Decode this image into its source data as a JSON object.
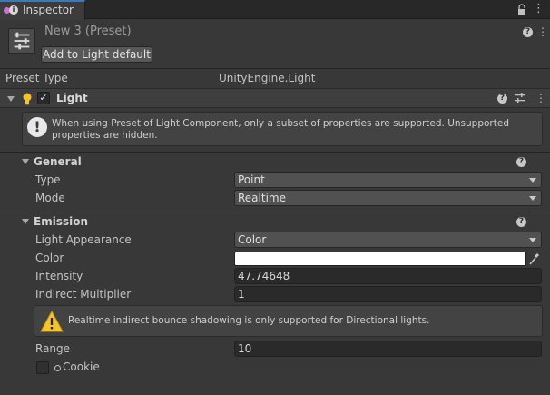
{
  "window": {
    "tab_title": "Inspector"
  },
  "header": {
    "preset_title": "New 3 (Preset)",
    "add_button_label": "Add to Light default"
  },
  "preset_type": {
    "label": "Preset Type",
    "value": "UnityEngine.Light"
  },
  "component": {
    "title": "Light",
    "enabled": true,
    "info_message": "When using Preset of Light Component, only a subset of properties are supported.  Unsupported properties are hidden."
  },
  "general": {
    "title": "General",
    "type_label": "Type",
    "type_value": "Point",
    "mode_label": "Mode",
    "mode_value": "Realtime"
  },
  "emission": {
    "title": "Emission",
    "appearance_label": "Light Appearance",
    "appearance_value": "Color",
    "color_label": "Color",
    "color_value": "#ffffff",
    "intensity_label": "Intensity",
    "intensity_value": "47.74648",
    "indirect_label": "Indirect Multiplier",
    "indirect_value": "1",
    "warning_message": "Realtime indirect bounce shadowing is only supported for Directional lights.",
    "range_label": "Range",
    "range_value": "10",
    "cookie_label": "Cookie"
  },
  "colors": {
    "background": "#383838",
    "accent": "#3a79bb",
    "warning": "#f4c430"
  }
}
